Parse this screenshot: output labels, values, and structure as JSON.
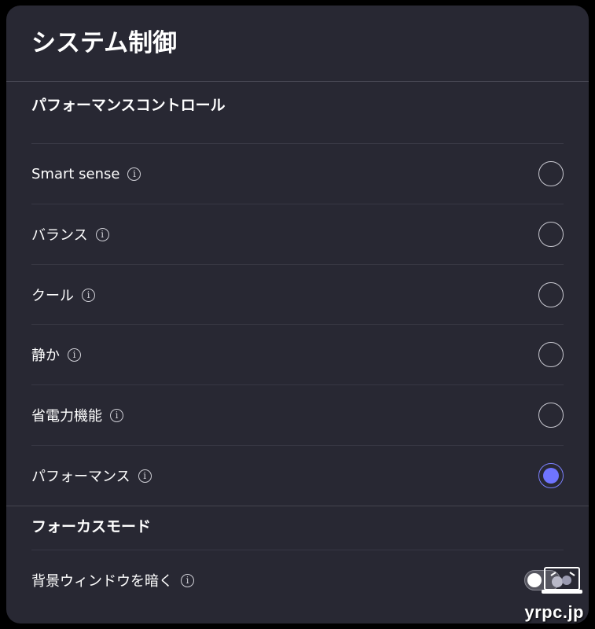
{
  "window": {
    "title": "システム制御"
  },
  "performance_control": {
    "heading": "パフォーマンスコントロール",
    "options": [
      {
        "label": "Smart sense",
        "selected": false
      },
      {
        "label": "バランス",
        "selected": false
      },
      {
        "label": "クール",
        "selected": false
      },
      {
        "label": "静か",
        "selected": false
      },
      {
        "label": "省電力機能",
        "selected": false
      },
      {
        "label": "パフォーマンス",
        "selected": true
      }
    ]
  },
  "focus_mode": {
    "heading": "フォーカスモード",
    "dim_background": {
      "label": "背景ウィンドウを暗く",
      "enabled": false
    }
  },
  "icons": {
    "info": "i"
  },
  "watermark": {
    "text": "yrpc.jp"
  },
  "colors": {
    "panel_bg": "#282833",
    "accent": "#6f74ff",
    "text": "#ffffff",
    "divider": "#45454f"
  }
}
